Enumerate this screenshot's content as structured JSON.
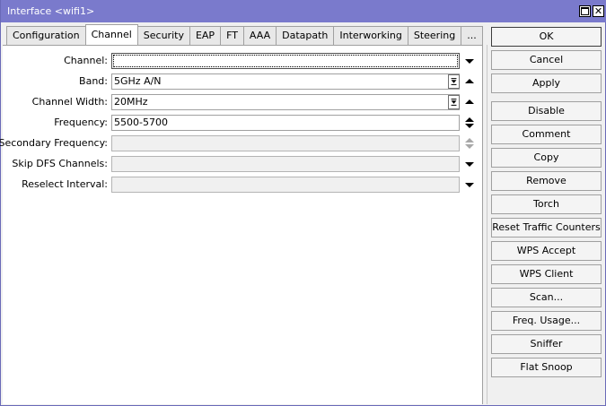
{
  "window": {
    "title": "Interface <wifi1>"
  },
  "tabs": [
    "Configuration",
    "Channel",
    "Security",
    "EAP",
    "FT",
    "AAA",
    "Datapath",
    "Interworking",
    "Steering",
    "..."
  ],
  "active_tab": "Channel",
  "fields": {
    "channel": {
      "label": "Channel:",
      "value": ""
    },
    "band": {
      "label": "Band:",
      "value": "5GHz A/N"
    },
    "channel_width": {
      "label": "Channel Width:",
      "value": "20MHz"
    },
    "frequency": {
      "label": "Frequency:",
      "value": "5500-5700"
    },
    "secondary_frequency": {
      "label": "Secondary Frequency:",
      "value": ""
    },
    "skip_dfs_channels": {
      "label": "Skip DFS Channels:",
      "value": ""
    },
    "reselect_interval": {
      "label": "Reselect Interval:",
      "value": ""
    }
  },
  "buttons": {
    "ok": "OK",
    "cancel": "Cancel",
    "apply": "Apply",
    "disable": "Disable",
    "comment": "Comment",
    "copy": "Copy",
    "remove": "Remove",
    "torch": "Torch",
    "reset_traffic_counters": "Reset Traffic Counters",
    "wps_accept": "WPS Accept",
    "wps_client": "WPS Client",
    "scan": "Scan...",
    "freq_usage": "Freq. Usage...",
    "sniffer": "Sniffer",
    "flat_snoop": "Flat Snoop"
  },
  "colors": {
    "titlebar": "#7a7acc",
    "panel": "#ffffff",
    "window": "#f0f0f0"
  }
}
